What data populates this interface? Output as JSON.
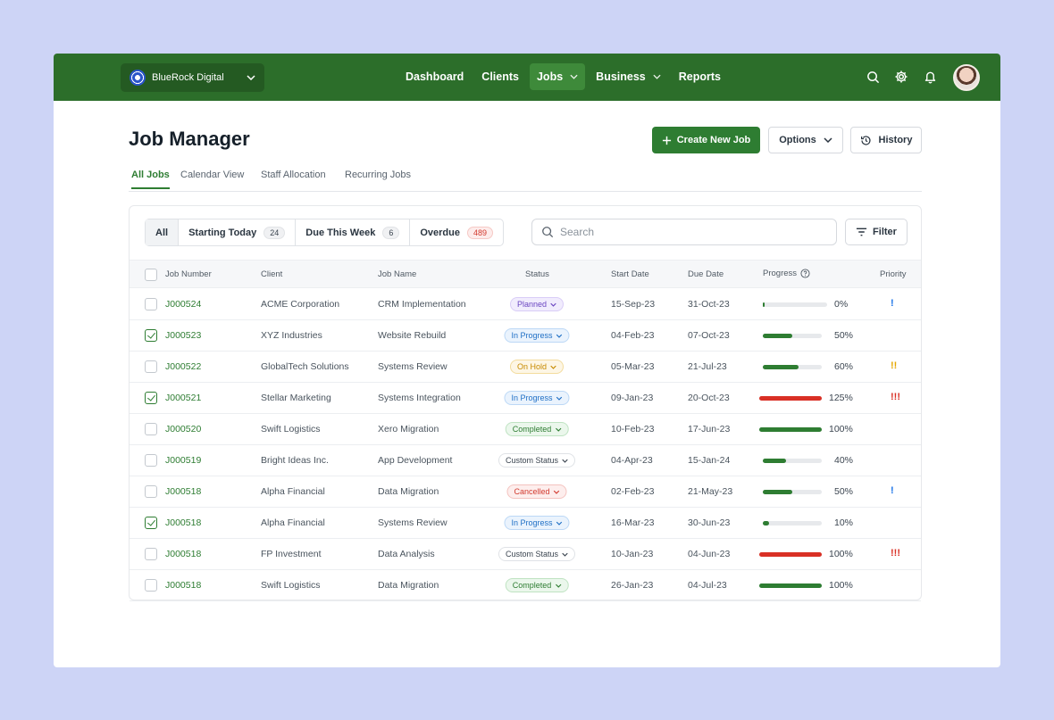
{
  "app": {
    "org_name": "BlueRock Digital",
    "nav": [
      {
        "label": "Dashboard"
      },
      {
        "label": "Clients"
      },
      {
        "label": "Jobs"
      },
      {
        "label": "Business"
      },
      {
        "label": "Reports"
      }
    ]
  },
  "page": {
    "title": "Job Manager",
    "create_label": "Create New Job",
    "options_label": "Options",
    "history_label": "History",
    "tabs": [
      "All Jobs",
      "Calendar View",
      "Staff Allocation",
      "Recurring Jobs"
    ]
  },
  "filters": {
    "all": "All",
    "starting_today": {
      "label": "Starting Today",
      "count": "24"
    },
    "due_this_week": {
      "label": "Due This Week",
      "count": "6"
    },
    "overdue": {
      "label": "Overdue",
      "count": "489"
    }
  },
  "search": {
    "placeholder": "Search"
  },
  "filter_label": "Filter",
  "columns": [
    "Job Number",
    "Client",
    "Job Name",
    "Status",
    "Start Date",
    "Due Date",
    "Progress",
    "Priority"
  ],
  "colors": {
    "brand": "#2c6e2a",
    "progress_normal": "#2e7d32",
    "progress_over": "#d93025",
    "priority_low": "#1a73e8",
    "priority_medium": "#e6a700",
    "priority_high": "#d93025"
  },
  "rows": [
    {
      "checked": false,
      "job": "J000524",
      "client": "ACME Corporation",
      "name": "CRM Implementation",
      "status": "Planned",
      "start": "15-Sep-23",
      "due": "31-Oct-23",
      "progress": 0,
      "progress_label": "0%",
      "priority": "!"
    },
    {
      "checked": true,
      "job": "J000523",
      "client": "XYZ Industries",
      "name": "Website Rebuild",
      "status": "In Progress",
      "start": "04-Feb-23",
      "due": "07-Oct-23",
      "progress": 50,
      "progress_label": "50%",
      "priority": ""
    },
    {
      "checked": false,
      "job": "J000522",
      "client": "GlobalTech Solutions",
      "name": "Systems Review",
      "status": "On Hold",
      "start": "05-Mar-23",
      "due": "21-Jul-23",
      "progress": 60,
      "progress_label": "60%",
      "priority": "!!"
    },
    {
      "checked": true,
      "job": "J000521",
      "client": "Stellar Marketing",
      "name": "Systems Integration",
      "status": "In Progress",
      "start": "09-Jan-23",
      "due": "20-Oct-23",
      "progress": 125,
      "progress_label": "125%",
      "priority": "!!!"
    },
    {
      "checked": false,
      "job": "J000520",
      "client": "Swift Logistics",
      "name": "Xero Migration",
      "status": "Completed",
      "start": "10-Feb-23",
      "due": "17-Jun-23",
      "progress": 100,
      "progress_label": "100%",
      "priority": ""
    },
    {
      "checked": false,
      "job": "J000519",
      "client": "Bright Ideas Inc.",
      "name": "App Development",
      "status": "Custom Status",
      "start": "04-Apr-23",
      "due": "15-Jan-24",
      "progress": 40,
      "progress_label": "40%",
      "priority": ""
    },
    {
      "checked": false,
      "job": "J000518",
      "client": "Alpha Financial",
      "name": "Data Migration",
      "status": "Cancelled",
      "start": "02-Feb-23",
      "due": "21-May-23",
      "progress": 50,
      "progress_label": "50%",
      "priority": "!"
    },
    {
      "checked": true,
      "job": "J000518",
      "client": "Alpha Financial",
      "name": "Systems Review",
      "status": "In Progress",
      "start": "16-Mar-23",
      "due": "30-Jun-23",
      "progress": 10,
      "progress_label": "10%",
      "priority": ""
    },
    {
      "checked": false,
      "job": "J000518",
      "client": "FP Investment",
      "name": "Data Analysis",
      "status": "Custom Status",
      "start": "10-Jan-23",
      "due": "04-Jun-23",
      "progress": 100,
      "progress_label": "100%",
      "progress_over": true,
      "priority": "!!!"
    },
    {
      "checked": false,
      "job": "J000518",
      "client": "Swift Logistics",
      "name": "Data Migration",
      "status": "Completed",
      "start": "26-Jan-23",
      "due": "04-Jul-23",
      "progress": 100,
      "progress_label": "100%",
      "priority": ""
    }
  ]
}
